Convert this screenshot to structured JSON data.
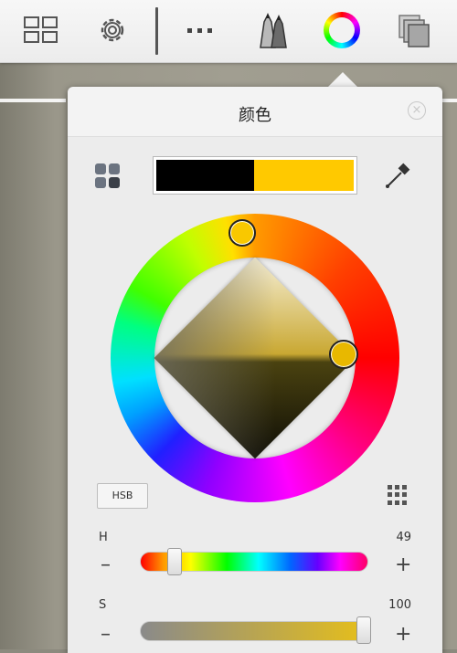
{
  "toolbar": {
    "items": [
      {
        "name": "gallery-icon"
      },
      {
        "name": "settings-icon"
      },
      {
        "name": "more-icon"
      },
      {
        "name": "brushes-icon"
      },
      {
        "name": "color-wheel-icon"
      },
      {
        "name": "layers-icon"
      }
    ]
  },
  "color_panel": {
    "title": "颜色",
    "close_icon": "close-icon",
    "swatches": {
      "previous": "#000000",
      "current": "#ffc900"
    },
    "mode_button_label": "HSB",
    "sliders": [
      {
        "label": "H",
        "value": "49",
        "minus": "–",
        "plus": "+"
      },
      {
        "label": "S",
        "value": "100",
        "minus": "–",
        "plus": "+"
      }
    ]
  }
}
